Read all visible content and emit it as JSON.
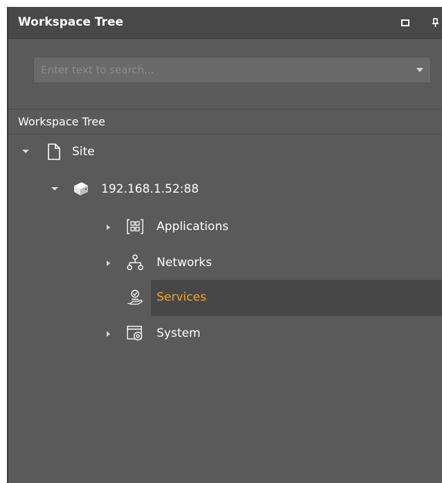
{
  "panel": {
    "title": "Workspace Tree",
    "buttons": [
      {
        "name": "float-window-icon"
      },
      {
        "name": "pin-icon"
      }
    ]
  },
  "search": {
    "placeholder": "Enter text to search...",
    "value": ""
  },
  "tree": {
    "header": "Workspace Tree",
    "nodes": [
      {
        "label": "Site",
        "icon": "document-icon",
        "expanded": true,
        "selected": false
      },
      {
        "label": "192.168.1.52:88",
        "icon": "server-icon",
        "expanded": true,
        "selected": false
      },
      {
        "label": "Applications",
        "icon": "applications-icon",
        "expanded": false,
        "selected": false
      },
      {
        "label": "Networks",
        "icon": "networks-icon",
        "expanded": false,
        "selected": false
      },
      {
        "label": "Services",
        "icon": "services-icon",
        "expanded": null,
        "selected": true
      },
      {
        "label": "System",
        "icon": "system-icon",
        "expanded": false,
        "selected": false
      }
    ]
  },
  "colors": {
    "panel_bg": "#5a5a5a",
    "titlebar_bg": "#484848",
    "selected_bg": "#474747",
    "selected_text": "#f0a81c",
    "text": "#ffffff"
  }
}
